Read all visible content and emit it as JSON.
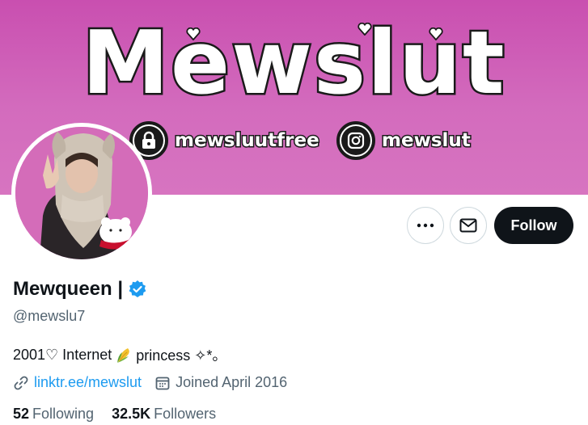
{
  "banner": {
    "title": "Mewslut",
    "handles": [
      {
        "icon": "lock-icon",
        "text": "mewsluutfree"
      },
      {
        "icon": "instagram-icon",
        "text": "mewslut"
      }
    ],
    "colors": {
      "background": "#cf5fb8",
      "outline": "#1a1a1a"
    }
  },
  "profile": {
    "display_name": "Mewqueen |",
    "verified_icon": "verified-badge-icon",
    "handle": "@mewslu7",
    "bio": {
      "before": "2001♡ Internet",
      "emoji_icon": "corn-icon",
      "after": "princess ✧*。"
    },
    "link": "linktr.ee/mewslut",
    "joined": "Joined April 2016"
  },
  "actions": {
    "more_icon": "more-dots-icon",
    "message_icon": "envelope-icon",
    "follow_label": "Follow"
  },
  "stats": {
    "following_count": "52",
    "following_label": "Following",
    "followers_count": "32.5K",
    "followers_label": "Followers"
  },
  "colors": {
    "accent": "#1d9bf0",
    "text": "#0f1419",
    "muted": "#536471"
  }
}
